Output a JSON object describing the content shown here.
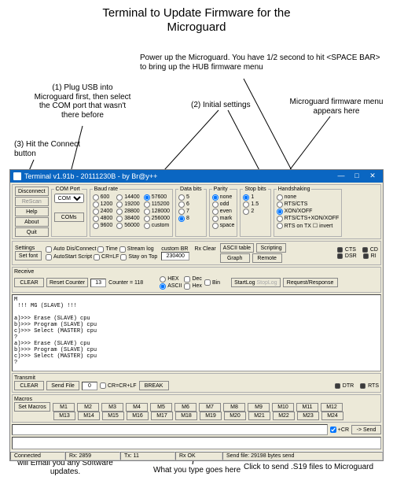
{
  "title_line1": "Terminal to Update Firmware for the",
  "title_line2": "Microguard",
  "annotations": {
    "spacebar": "Power up the Microguard. You have 1/2 second to hit <SPACE BAR> to bring up the HUB firmware menu",
    "plug_usb": "(1) Plug USB into Microguard first, then select the COM port that wasn't there before",
    "initial": "(2) Initial settings",
    "menu_here": "Microguard firmware menu appears here",
    "hit_connect": "(3) Hit the Connect button",
    "factory": "You will need to tell the Factory what letter or number this is before they will Email you any Software updates.",
    "type_here": "What you type goes here",
    "click_send": "Click to send .S19 files to Microguard"
  },
  "window": {
    "title": "Terminal v1.91b - 20111230B - by Br@y++",
    "left_buttons": {
      "disconnect": "Disconnect",
      "rescan": "ReScan",
      "help": "Help",
      "about": "About",
      "quit": "Quit"
    },
    "comport": {
      "legend": "COM Port",
      "value": "COM3",
      "coms_btn": "COMs"
    },
    "baud": {
      "legend": "Baud rate",
      "cols": [
        [
          "600",
          "1200",
          "2400",
          "4800",
          "9600"
        ],
        [
          "14400",
          "19200",
          "28800",
          "38400",
          "56000"
        ],
        [
          "57600",
          "115200",
          "128000",
          "256000",
          "custom"
        ]
      ],
      "selected": "57600"
    },
    "databits": {
      "legend": "Data bits",
      "opts": [
        "5",
        "6",
        "7",
        "8"
      ],
      "selected": "8"
    },
    "parity": {
      "legend": "Parity",
      "opts": [
        "none",
        "odd",
        "even",
        "mark",
        "space"
      ],
      "selected": "none"
    },
    "stopbits": {
      "legend": "Stop bits",
      "opts": [
        "1",
        "1.5",
        "2"
      ],
      "selected": "1"
    },
    "handshaking": {
      "legend": "Handshaking",
      "opts": [
        "none",
        "RTS/CTS",
        "XON/XOFF",
        "RTS/CTS+XON/XOFF",
        "RTS on TX ☐ invert"
      ],
      "selected": "XON/XOFF"
    },
    "settings": {
      "legend": "Settings",
      "setfont": "Set font",
      "checks": [
        "Auto Dis/Connect",
        "Time",
        "Stream log",
        "AutoStart Script",
        "CR=LF",
        "Stay on Top"
      ],
      "custom_br_label": "custom BR",
      "rx_clear_label": "Rx Clear",
      "custom_br_value": "230400",
      "ascii_table": "ASCII table",
      "scripting": "Scripting",
      "graph": "Graph",
      "remote": "Remote",
      "right_leds": [
        "CTS",
        "DSR",
        "CD",
        "RI"
      ]
    },
    "receive": {
      "legend": "Receive",
      "clear": "CLEAR",
      "reset": "Reset Counter",
      "cnt_val": "13",
      "counter_label": "Counter = 118",
      "mode_hex": "HEX",
      "mode_ascii": "ASCII",
      "dec": "Dec",
      "bin": "Bin",
      "hex2": "Hex",
      "startlog": "StartLog",
      "stoplog": "StopLog",
      "reqres": "Request/Response",
      "content": "M\n !!! MG (SLAVE) !!!\n\na)>>> Erase (SLAVE) cpu\nb)>>> Program (SLAVE) cpu\nc)>>> Select (MASTER) cpu\n?\na)>>> Erase (SLAVE) cpu\nb)>>> Program (SLAVE) cpu\nc)>>> Select (MASTER) cpu\n?"
    },
    "transmit": {
      "legend": "Transmit",
      "clear": "CLEAR",
      "sendfile": "Send File",
      "cnt": "0",
      "crlf": "CR=CR+LF",
      "break": "BREAK",
      "leds": [
        "DTR",
        "RTS"
      ]
    },
    "macros": {
      "legend": "Macros",
      "set": "Set Macros",
      "row1": [
        "M1",
        "M2",
        "M3",
        "M4",
        "M5",
        "M6",
        "M7",
        "M8",
        "M9",
        "M10",
        "M11",
        "M12"
      ],
      "row2": [
        "M13",
        "M14",
        "M15",
        "M16",
        "M17",
        "M18",
        "M19",
        "M20",
        "M21",
        "M22",
        "M23",
        "M24"
      ],
      "cr_check": "+CR",
      "send": "-> Send"
    },
    "status": {
      "connected": "Connected",
      "rx": "Rx: 2859",
      "tx": "Tx: 11",
      "rxok": "Rx OK",
      "sendfile": "Send file: 29198 bytes send"
    }
  }
}
